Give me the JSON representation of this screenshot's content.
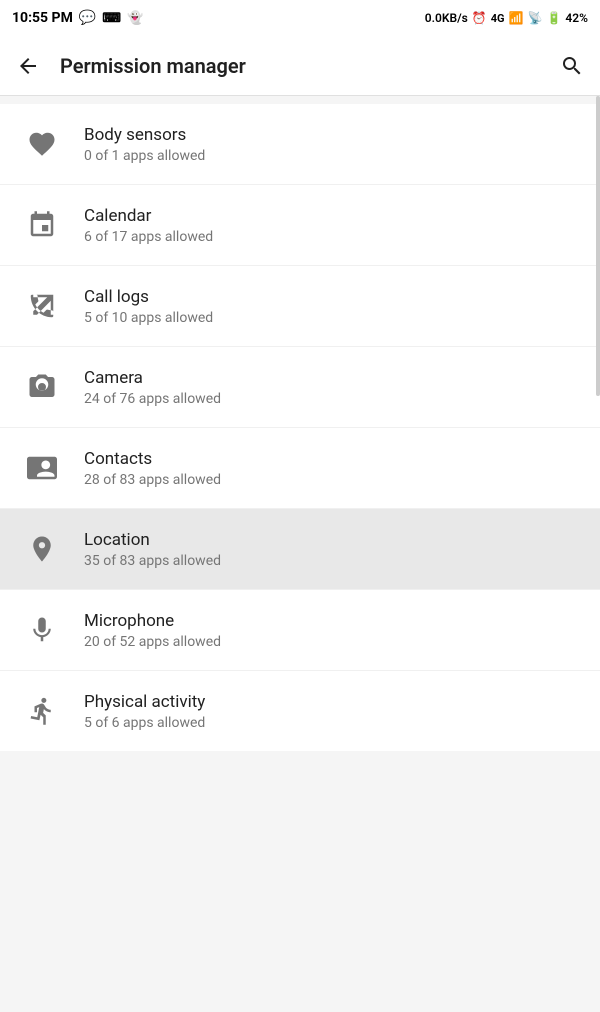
{
  "statusBar": {
    "time": "10:55 PM",
    "network": "0.0KB/s",
    "battery": "42%",
    "batteryIcon": "⚡"
  },
  "header": {
    "title": "Permission manager",
    "backLabel": "←",
    "searchLabel": "🔍"
  },
  "permissions": [
    {
      "id": "body-sensors",
      "name": "Body sensors",
      "desc": "0 of 1 apps allowed",
      "icon": "heart",
      "highlighted": false
    },
    {
      "id": "calendar",
      "name": "Calendar",
      "desc": "6 of 17 apps allowed",
      "icon": "calendar",
      "highlighted": false
    },
    {
      "id": "call-logs",
      "name": "Call logs",
      "desc": "5 of 10 apps allowed",
      "icon": "call-logs",
      "highlighted": false
    },
    {
      "id": "camera",
      "name": "Camera",
      "desc": "24 of 76 apps allowed",
      "icon": "camera",
      "highlighted": false
    },
    {
      "id": "contacts",
      "name": "Contacts",
      "desc": "28 of 83 apps allowed",
      "icon": "contacts",
      "highlighted": false
    },
    {
      "id": "location",
      "name": "Location",
      "desc": "35 of 83 apps allowed",
      "icon": "location",
      "highlighted": true
    },
    {
      "id": "microphone",
      "name": "Microphone",
      "desc": "20 of 52 apps allowed",
      "icon": "microphone",
      "highlighted": false
    },
    {
      "id": "physical-activity",
      "name": "Physical activity",
      "desc": "5 of 6 apps allowed",
      "icon": "running",
      "highlighted": false
    }
  ]
}
